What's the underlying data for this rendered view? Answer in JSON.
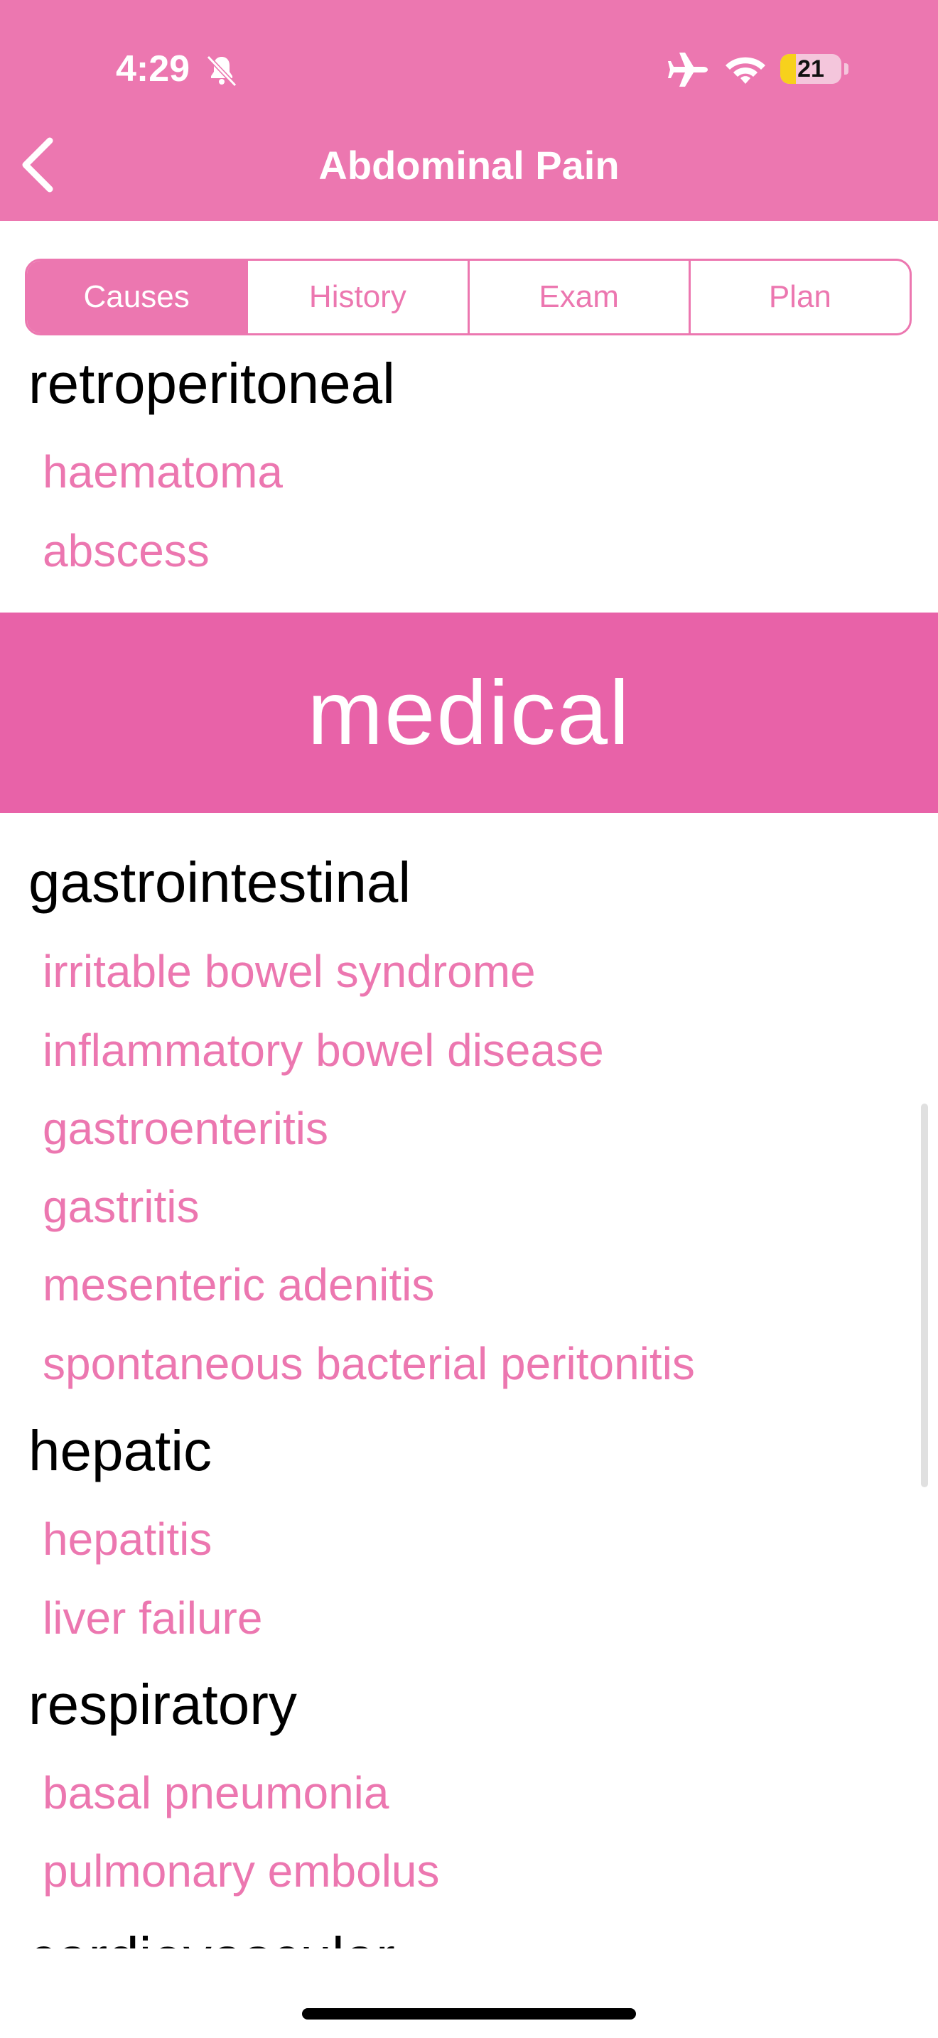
{
  "status_bar": {
    "time": "4:29",
    "battery": "21"
  },
  "nav": {
    "title": "Abdominal Pain"
  },
  "tabs": [
    {
      "label": "Causes",
      "active": true
    },
    {
      "label": "History",
      "active": false
    },
    {
      "label": "Exam",
      "active": false
    },
    {
      "label": "Plan",
      "active": false
    }
  ],
  "sections": {
    "retroperitoneal": {
      "heading": "retroperitoneal",
      "items": [
        "haematoma",
        "abscess"
      ]
    },
    "medical_band": "medical",
    "gastrointestinal": {
      "heading": "gastrointestinal",
      "items": [
        "irritable bowel syndrome",
        "inflammatory bowel disease",
        "gastroenteritis",
        "gastritis",
        "mesenteric adenitis",
        "spontaneous bacterial peritonitis"
      ]
    },
    "hepatic": {
      "heading": "hepatic",
      "items": [
        "hepatitis",
        "liver failure"
      ]
    },
    "respiratory": {
      "heading": "respiratory",
      "items": [
        "basal pneumonia",
        "pulmonary embolus"
      ]
    },
    "cardiovascular": {
      "heading": "cardiovascular"
    }
  },
  "colors": {
    "accent": "#EC77B0",
    "band": "#E862A8"
  }
}
